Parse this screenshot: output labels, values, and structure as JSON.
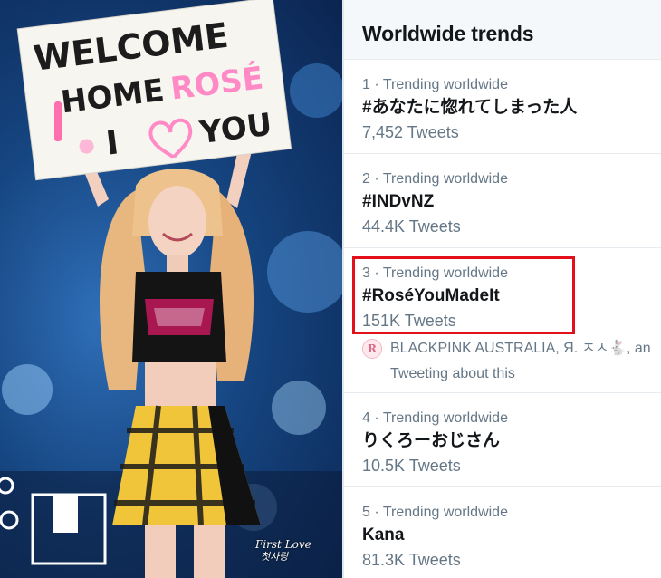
{
  "photo": {
    "sign_lines": [
      "WELCOME",
      "HOME",
      "ROSÉ",
      "I",
      "YOU"
    ],
    "watermark_line1": "First Love",
    "watermark_line2": "첫사랑"
  },
  "trends": {
    "title": "Worldwide trends",
    "items": [
      {
        "meta": "1 · Trending worldwide",
        "name": "#あなたに惚れてしまった人",
        "count": "7,452 Tweets"
      },
      {
        "meta": "2 · Trending worldwide",
        "name": "#INDvNZ",
        "count": "44.4K Tweets"
      },
      {
        "meta": "3 · Trending worldwide",
        "name": "#RoséYouMadeIt",
        "count": "151K Tweets",
        "context_names": "BLACKPINK AUSTRALIA, Я. ㅈㅅ🐇, an",
        "context_sub": "Tweeting about this",
        "context_avatar": "R"
      },
      {
        "meta": "4 · Trending worldwide",
        "name": "りくろーおじさん",
        "count": "10.5K Tweets"
      },
      {
        "meta": "5 · Trending worldwide",
        "name": "Kana",
        "count": "81.3K Tweets"
      }
    ]
  },
  "colors": {
    "highlight": "#e3101c",
    "secondary_text": "#657786",
    "primary_text": "#14171a"
  }
}
